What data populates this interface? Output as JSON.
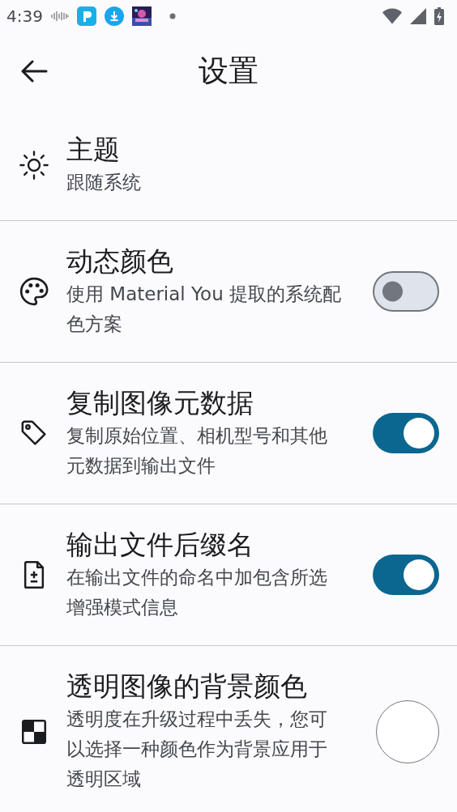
{
  "status_bar": {
    "time": "4:39"
  },
  "app_bar": {
    "title": "设置"
  },
  "settings": [
    {
      "kind": "value",
      "title": "主题",
      "subtitle": "跟随系统"
    },
    {
      "kind": "switch",
      "title": "动态颜色",
      "subtitle": "使用 Material You 提取的系统配色方案",
      "on": false
    },
    {
      "kind": "switch",
      "title": "复制图像元数据",
      "subtitle": "复制原始位置、相机型号和其他元数据到输出文件",
      "on": true
    },
    {
      "kind": "switch",
      "title": "输出文件后缀名",
      "subtitle": "在输出文件的命名中加包含所选增强模式信息",
      "on": true
    },
    {
      "kind": "color",
      "title": "透明图像的背景颜色",
      "subtitle": "透明度在升级过程中丢失，您可以选择一种颜色作为背景应用于透明区域",
      "color": "#ffffff"
    }
  ]
}
